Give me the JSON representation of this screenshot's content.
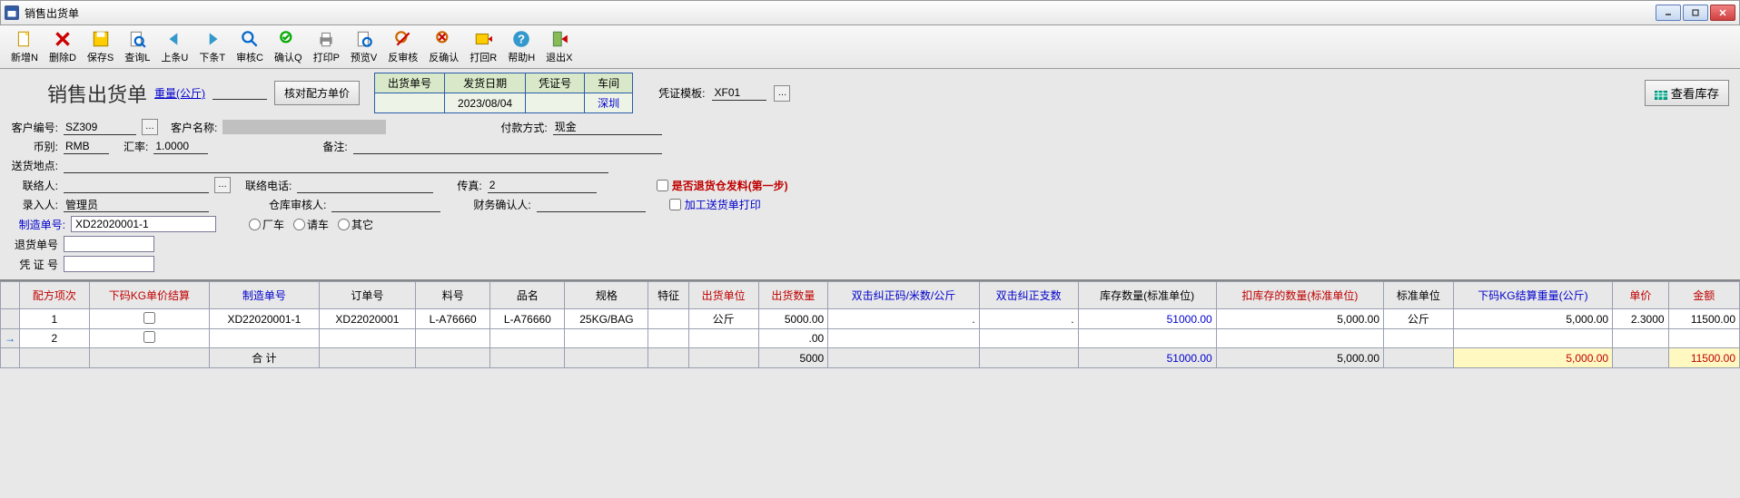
{
  "window": {
    "title": "销售出货单"
  },
  "toolbar": [
    {
      "id": "new",
      "label": "新增N"
    },
    {
      "id": "delete",
      "label": "删除D"
    },
    {
      "id": "save",
      "label": "保存S"
    },
    {
      "id": "query",
      "label": "查询L"
    },
    {
      "id": "prev",
      "label": "上条U"
    },
    {
      "id": "next",
      "label": "下条T"
    },
    {
      "id": "audit",
      "label": "审核C"
    },
    {
      "id": "confirm",
      "label": "确认Q"
    },
    {
      "id": "print",
      "label": "打印P"
    },
    {
      "id": "preview",
      "label": "预览V"
    },
    {
      "id": "unaudit",
      "label": "反审核"
    },
    {
      "id": "unconfirm",
      "label": "反确认"
    },
    {
      "id": "return",
      "label": "打回R"
    },
    {
      "id": "help",
      "label": "帮助H"
    },
    {
      "id": "exit",
      "label": "退出X"
    }
  ],
  "form": {
    "title": "销售出货单",
    "weight_link": "重量(公斤)",
    "check_price_btn": "核对配方单价",
    "header_cols": [
      "出货单号",
      "发货日期",
      "凭证号",
      "车间"
    ],
    "header_vals": [
      "",
      "2023/08/04",
      "",
      "深圳"
    ],
    "voucher_tpl_label": "凭证模板:",
    "voucher_tpl": "XF01",
    "view_inventory_btn": "查看库存",
    "customer_code_label": "客户编号:",
    "customer_code": "SZ309",
    "customer_name_label": "客户名称:",
    "pay_method_label": "付款方式:",
    "pay_method": "现金",
    "currency_label": "币别:",
    "currency": "RMB",
    "rate_label": "汇率:",
    "rate": "1.0000",
    "remark_label": "备注:",
    "ship_addr_label": "送货地点:",
    "contact_label": "联络人:",
    "contact_phone_label": "联络电话:",
    "fax_label": "传真:",
    "fax": "2",
    "chk_return_label": "是否退货仓发料(第一步)",
    "chk_process_label": "加工送货单打印",
    "entered_by_label": "录入人:",
    "entered_by": "管理员",
    "wh_auditor_label": "仓库审核人:",
    "fin_confirm_label": "财务确认人:",
    "mfg_order_label": "制造单号:",
    "mfg_order": "XD22020001-1",
    "radio_factory": "厂车",
    "radio_hire": "请车",
    "radio_other": "其它",
    "return_no_label": "退货单号",
    "voucher_no_label": "凭 证 号"
  },
  "grid": {
    "columns": [
      "配方项次",
      "下码KG单价结算",
      "制造单号",
      "订单号",
      "料号",
      "品名",
      "规格",
      "特征",
      "出货单位",
      "出货数量",
      "双击纠正码/米数/公斤",
      "双击纠正支数",
      "库存数量(标准单位)",
      "扣库存的数量(标准单位)",
      "标准单位",
      "下码KG结算重量(公斤)",
      "单价",
      "金额"
    ],
    "rows": [
      {
        "seq": "1",
        "chk": false,
        "mfg": "XD22020001-1",
        "order": "XD22020001",
        "itemno": "L-A76660",
        "itemname": "L-A76660",
        "spec": "25KG/BAG",
        "feature": "",
        "unit": "公斤",
        "qty": "5000.00",
        "fix1": ".",
        "fix2": ".",
        "stock": "51000.00",
        "deduct": "5,000.00",
        "stdunit": "公斤",
        "kgweight": "5,000.00",
        "price": "2.3000",
        "amount": "11500.00"
      },
      {
        "seq": "2",
        "chk": false,
        "mfg": "",
        "order": "",
        "itemno": "",
        "itemname": "",
        "spec": "",
        "feature": "",
        "unit": "",
        "qty": ".00",
        "fix1": "",
        "fix2": "",
        "stock": "",
        "deduct": "",
        "stdunit": "",
        "kgweight": "",
        "price": "",
        "amount": ""
      }
    ],
    "total_label": "合  计",
    "total": {
      "qty": "5000",
      "stock": "51000.00",
      "deduct": "5,000.00",
      "kgweight": "5,000.00",
      "amount": "11500.00"
    }
  }
}
